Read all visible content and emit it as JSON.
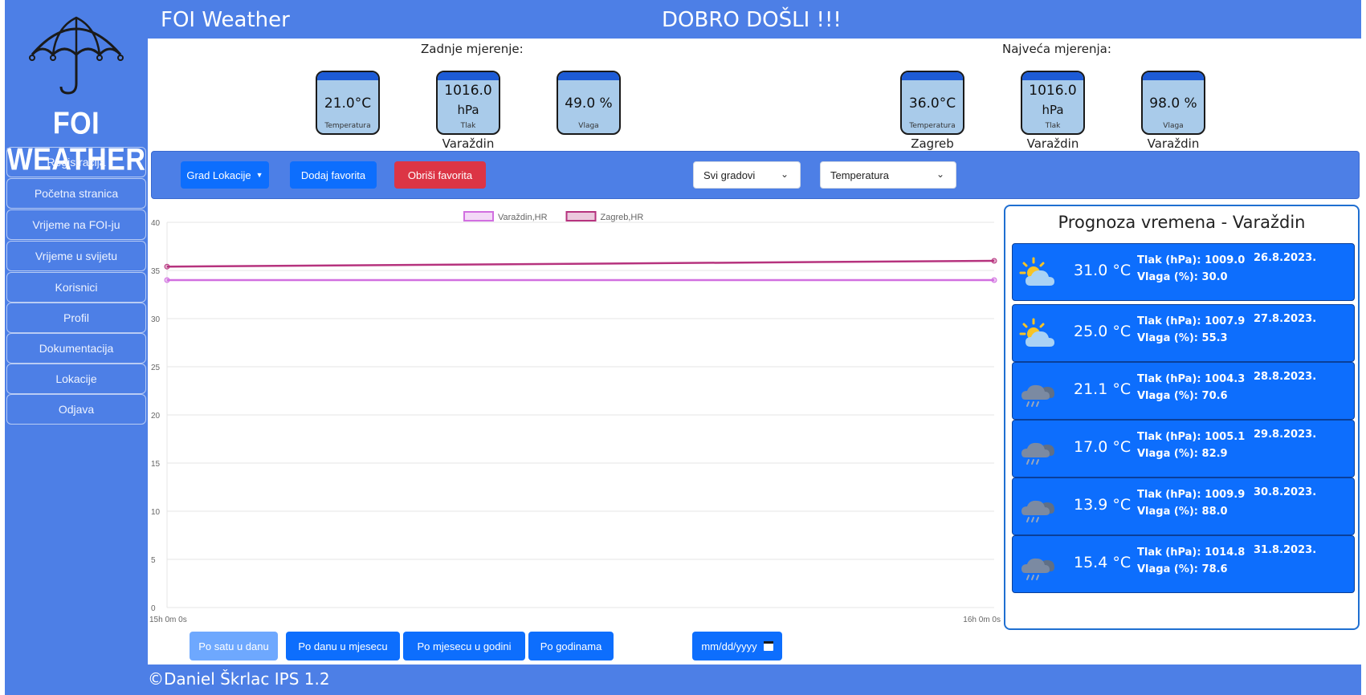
{
  "header": {
    "app_title": "FOI Weather",
    "welcome": "DOBRO DOŠLI !!!"
  },
  "logo": {
    "text": "FOI WEATHER",
    "icon": "umbrella-icon"
  },
  "sidebar": {
    "items": [
      {
        "label": "Registracija"
      },
      {
        "label": "Početna stranica"
      },
      {
        "label": "Vrijeme na FOI-ju"
      },
      {
        "label": "Vrijeme u svijetu"
      },
      {
        "label": "Korisnici"
      },
      {
        "label": "Profil"
      },
      {
        "label": "Dokumentacija"
      },
      {
        "label": "Lokacije"
      },
      {
        "label": "Odjava"
      }
    ]
  },
  "last": {
    "heading": "Zadnje mjerenje:",
    "temperature": {
      "value": "21.0°C",
      "label": "Temperatura"
    },
    "pressure": {
      "value": "1016.0",
      "unit": "hPa",
      "label": "Tlak",
      "city": "Varaždin"
    },
    "humidity": {
      "value": "49.0 %",
      "label": "Vlaga"
    }
  },
  "max": {
    "heading": "Najveća mjerenja:",
    "temperature": {
      "value": "36.0°C",
      "label": "Temperatura",
      "city": "Zagreb"
    },
    "pressure": {
      "value": "1016.0",
      "unit": "hPa",
      "label": "Tlak",
      "city": "Varaždin"
    },
    "humidity": {
      "value": "98.0 %",
      "label": "Vlaga",
      "city": "Varaždin"
    }
  },
  "toolbar": {
    "city_dropdown": "Grad Lokacije",
    "add_favorite": "Dodaj favorita",
    "remove_favorite": "Obriši favorita",
    "cities_select": "Svi gradovi",
    "metric_select": "Temperatura"
  },
  "chart_data": {
    "type": "line",
    "x": [
      "15h 0m 0s",
      "16h 0m 0s"
    ],
    "series": [
      {
        "name": "Varaždin,HR",
        "values": [
          34,
          34
        ],
        "color": "#d16fe0"
      },
      {
        "name": "Zagreb,HR",
        "values": [
          35.4,
          36
        ],
        "color": "#b6337e"
      }
    ],
    "ylim": [
      0,
      40
    ],
    "yticks": [
      0,
      5,
      10,
      15,
      20,
      25,
      30,
      35,
      40
    ],
    "grid": true,
    "legend": "top-center"
  },
  "forecast": {
    "title": "Prognoza vremena - Varaždin",
    "items": [
      {
        "temp": "31.0 °C",
        "pressure": "Tlak (hPa): 1009.0",
        "humidity": "Vlaga (%): 30.0",
        "date": "26.8.2023.",
        "icon": "partly-cloudy-icon"
      },
      {
        "temp": "25.0 °C",
        "pressure": "Tlak (hPa): 1007.9",
        "humidity": "Vlaga (%): 55.3",
        "date": "27.8.2023.",
        "icon": "partly-cloudy-icon"
      },
      {
        "temp": "21.1 °C",
        "pressure": "Tlak (hPa): 1004.3",
        "humidity": "Vlaga (%): 70.6",
        "date": "28.8.2023.",
        "icon": "rain-cloud-icon"
      },
      {
        "temp": "17.0 °C",
        "pressure": "Tlak (hPa): 1005.1",
        "humidity": "Vlaga (%): 82.9",
        "date": "29.8.2023.",
        "icon": "rain-cloud-icon"
      },
      {
        "temp": "13.9 °C",
        "pressure": "Tlak (hPa): 1009.9",
        "humidity": "Vlaga (%): 88.0",
        "date": "30.8.2023.",
        "icon": "rain-cloud-icon"
      },
      {
        "temp": "15.4 °C",
        "pressure": "Tlak (hPa): 1014.8",
        "humidity": "Vlaga (%): 78.6",
        "date": "31.8.2023.",
        "icon": "rain-cloud-icon"
      }
    ]
  },
  "bottom": {
    "by_hour": "Po satu u danu",
    "by_day": "Po danu u mjesecu",
    "by_month": "Po mjesecu u godini",
    "by_year": "Po godinama",
    "date_placeholder": "mm/dd/yyyy"
  },
  "footer": {
    "text": "©Daniel Škrlac IPS 1.2"
  },
  "colors": {
    "primary": "#4d7fe6",
    "button": "#0d6efd",
    "danger": "#dc3545"
  }
}
